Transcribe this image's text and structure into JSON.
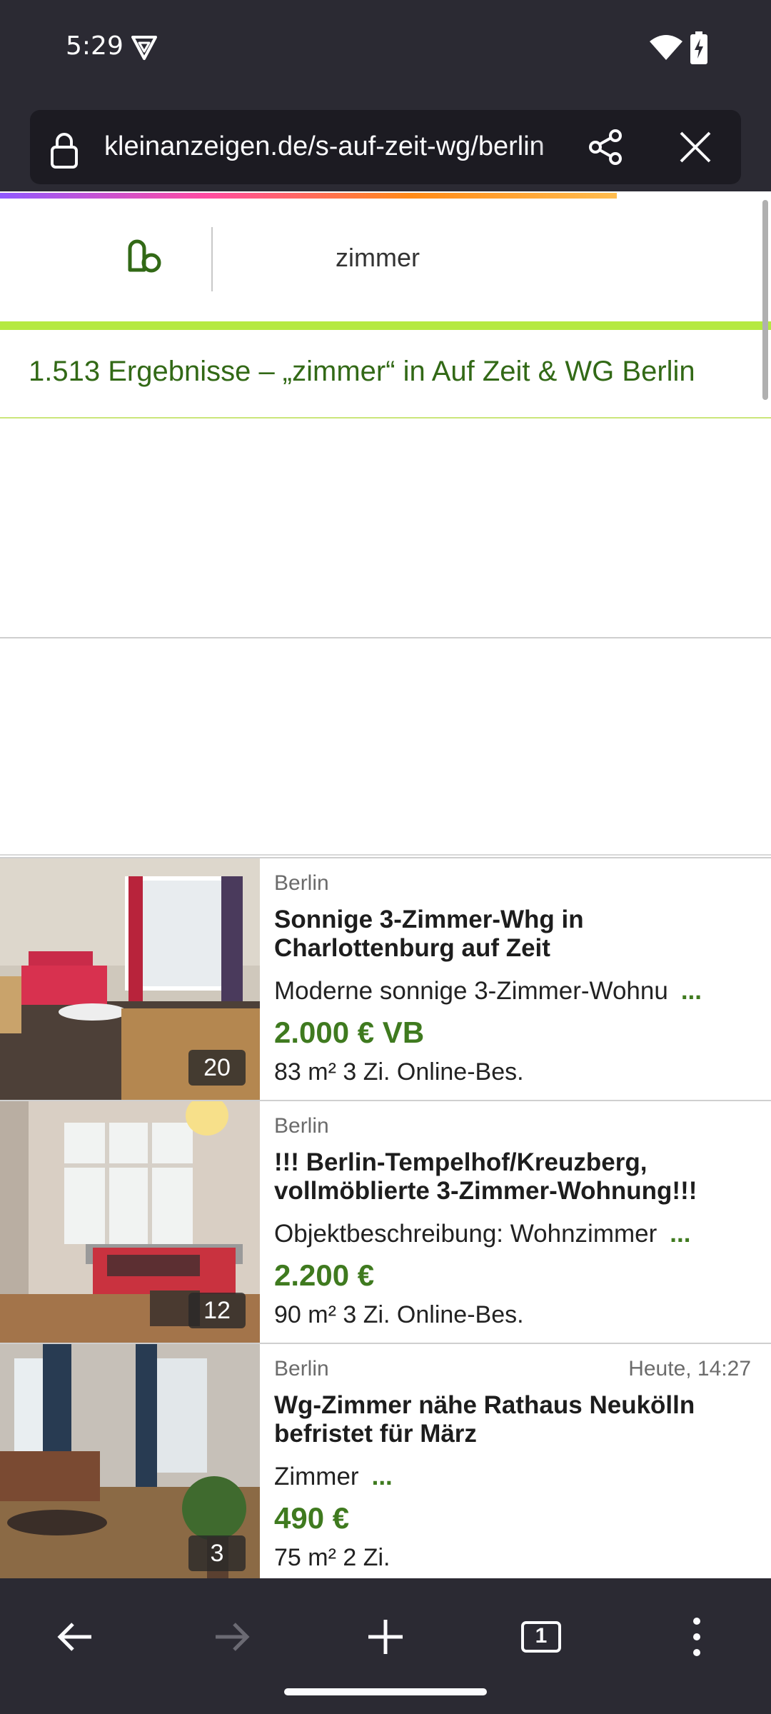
{
  "status": {
    "time": "5:29"
  },
  "browser": {
    "url": "kleinanzeigen.de/s-auf-zeit-wg/berlin",
    "progress_fraction": 0.8
  },
  "site": {
    "search_query": "zimmer",
    "results_heading": "1.513 Ergebnisse – „zimmer“ in Auf Zeit & WG Berlin",
    "accent_color": "#326916"
  },
  "listings": [
    {
      "location": "Berlin",
      "date": "",
      "title": "Sonnige 3-Zimmer-Whg in Charlottenburg auf Zeit",
      "description": "Moderne sonnige 3-Zimmer-Wohnu",
      "more": "...",
      "price": "2.000 € VB",
      "meta": "83 m² 3 Zi. Online-Bes.",
      "image_count": "20"
    },
    {
      "location": "Berlin",
      "date": "",
      "title": "!!! Berlin-Tempelhof/Kreuzberg, vollmöblierte 3-Zimmer-Wohnung!!!",
      "description": "Objektbeschreibung: Wohnzimmer",
      "more": "...",
      "price": "2.200 €",
      "meta": "90 m² 3 Zi. Online-Bes.",
      "image_count": "12"
    },
    {
      "location": "Berlin",
      "date": "Heute, 14:27",
      "title": "Wg-Zimmer nähe Rathaus Neukölln befristet für März",
      "description": "Zimmer",
      "more": "...",
      "price": "490 €",
      "meta": "75 m² 2 Zi.",
      "image_count": "3"
    }
  ],
  "bottom_nav": {
    "tab_count": "1",
    "icons": [
      "back-arrow-icon",
      "forward-arrow-icon",
      "plus-icon",
      "tabs-icon",
      "menu-icon"
    ]
  }
}
